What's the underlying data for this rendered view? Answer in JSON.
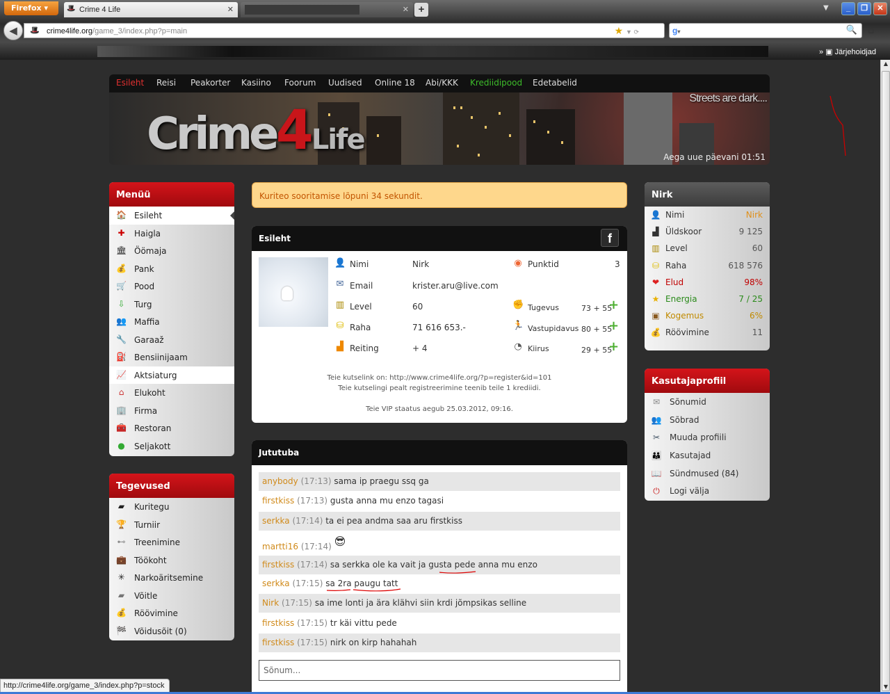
{
  "browser": {
    "menu_button": "Firefox",
    "tabs": [
      {
        "title": "Crime 4 Life"
      }
    ],
    "new_tab": "+",
    "url_host": "crime4life.org",
    "url_path": "/game_3/index.php?p=main",
    "bookmarks_label": "Järjehoidjad",
    "status_url": "http://crime4life.org/game_3/index.php?p=stock"
  },
  "topnav": {
    "items": [
      "Esileht",
      "Reisi",
      "Peakorter",
      "Kasiino",
      "Foorum",
      "Uudised",
      "Online 18",
      "Abi/KKK",
      "Krediidipood",
      "Edetabelid"
    ]
  },
  "banner": {
    "logo_pre": "Crime",
    "logo_num": "4",
    "logo_post": "Life",
    "tagline": "Streets are dark....",
    "new_day": "Aega uue päevani 01:51"
  },
  "menu": {
    "title": "Menüü",
    "items": [
      {
        "label": "Esileht",
        "icon": "home-icon"
      },
      {
        "label": "Haigla",
        "icon": "hospital-icon"
      },
      {
        "label": "Öömaja",
        "icon": "shelter-icon"
      },
      {
        "label": "Pank",
        "icon": "money-bag-icon"
      },
      {
        "label": "Pood",
        "icon": "cart-icon"
      },
      {
        "label": "Turg",
        "icon": "market-icon"
      },
      {
        "label": "Maffia",
        "icon": "mafia-icon"
      },
      {
        "label": "Garaaž",
        "icon": "garage-icon"
      },
      {
        "label": "Bensiinijaam",
        "icon": "fuel-icon"
      },
      {
        "label": "Aktsiaturg",
        "icon": "stock-chart-icon"
      },
      {
        "label": "Elukoht",
        "icon": "house-icon"
      },
      {
        "label": "Firma",
        "icon": "company-icon"
      },
      {
        "label": "Restoran",
        "icon": "restaurant-icon"
      },
      {
        "label": "Seljakott",
        "icon": "backpack-icon"
      }
    ]
  },
  "actions": {
    "title": "Tegevused",
    "items": [
      {
        "label": "Kuritegu",
        "icon": "gun-icon"
      },
      {
        "label": "Turniir",
        "icon": "trophy-icon"
      },
      {
        "label": "Treenimine",
        "icon": "dumbbell-icon"
      },
      {
        "label": "Töökoht",
        "icon": "briefcase-icon"
      },
      {
        "label": "Narkoäritsemine",
        "icon": "leaf-icon"
      },
      {
        "label": "Võitle",
        "icon": "pistol-icon"
      },
      {
        "label": "Röövimine",
        "icon": "loot-bag-icon"
      },
      {
        "label": "Võidusõit (0)",
        "icon": "race-flag-icon"
      }
    ]
  },
  "alert": "Kuriteo sooritamise lõpuni 34 sekundit.",
  "profile_panel": {
    "title": "Esileht",
    "fb": "f",
    "rows": [
      {
        "label": "Nimi",
        "value": "Nirk"
      },
      {
        "label": "Email",
        "value": "krister.aru@live.com"
      },
      {
        "label": "Level",
        "value": "60"
      },
      {
        "label": "Raha",
        "value": "71 616 653.-"
      },
      {
        "label": "Reiting",
        "value": "+ 4"
      }
    ],
    "stats": [
      {
        "label": "Punktid",
        "value": "3"
      },
      {
        "label": "Tugevus",
        "value": "73 + 55"
      },
      {
        "label": "Vastupidavus",
        "value": "80 + 55"
      },
      {
        "label": "Kiirus",
        "value": "29 + 55"
      }
    ],
    "invite_link": "Teie kutselink on: http://www.crime4life.org/?p=register&id=101",
    "invite_note": "Teie kutselingi pealt registreerimine teenib teile 1 krediidi.",
    "vip": "Teie VIP staatus aegub 25.03.2012, 09:16."
  },
  "chat": {
    "title": "Jututuba",
    "messages": [
      {
        "user": "anybody",
        "time": "(17:13)",
        "text": "sama ip praegu ssq ga"
      },
      {
        "user": "firstkiss",
        "time": "(17:13)",
        "text": "gusta anna mu enzo tagasi"
      },
      {
        "user": "serkka",
        "time": "(17:14)",
        "text": "ta ei pea andma saa aru firstkiss"
      },
      {
        "user": "martti16",
        "time": "(17:14)",
        "text": "😎"
      },
      {
        "user": "firstkiss",
        "time": "(17:14)",
        "text": "sa serkka ole ka vait ja gusta pede anna mu enzo"
      },
      {
        "user": "serkka",
        "time": "(17:15)",
        "text": "sa 2ra paugu tatt"
      },
      {
        "user": "Nirk",
        "time": "(17:15)",
        "text": "sa ime lonti ja ära klähvi siin krdi jõmpsikas selline"
      },
      {
        "user": "firstkiss",
        "time": "(17:15)",
        "text": "tr käi vittu pede"
      },
      {
        "user": "firstkiss",
        "time": "(17:15)",
        "text": "nirk on kirp hahahah"
      }
    ],
    "input_placeholder": "Sõnum..."
  },
  "user_box": {
    "title": "Nirk",
    "rows": [
      {
        "label": "Nimi",
        "value": "Nirk",
        "color": "#e0901a"
      },
      {
        "label": "Üldskoor",
        "value": "9 125",
        "color": "#555555"
      },
      {
        "label": "Level",
        "value": "60",
        "color": "#555555"
      },
      {
        "label": "Raha",
        "value": "618 576",
        "color": "#555555"
      },
      {
        "label": "Elud",
        "value": "98%",
        "color": "#c00000"
      },
      {
        "label": "Energia",
        "value": "7 / 25",
        "color": "#2a8a1a"
      },
      {
        "label": "Kogemus",
        "value": "6%",
        "color": "#c08a00"
      },
      {
        "label": "Röövimine",
        "value": "11",
        "color": "#555555"
      }
    ]
  },
  "user_profile": {
    "title": "Kasutajaprofiil",
    "items": [
      {
        "label": "Sõnumid",
        "icon": "envelope-icon"
      },
      {
        "label": "Sõbrad",
        "icon": "friends-icon"
      },
      {
        "label": "Muuda profiili",
        "icon": "tools-icon"
      },
      {
        "label": "Kasutajad",
        "icon": "users-icon"
      },
      {
        "label": "Sündmused (84)",
        "icon": "book-icon"
      },
      {
        "label": "Logi välja",
        "icon": "power-icon"
      }
    ]
  },
  "colors": {
    "accent_red": "#c8151a",
    "nav_active": "#e03030",
    "nav_credit": "#3dbb2a",
    "chat_name": "#d08a1a"
  }
}
